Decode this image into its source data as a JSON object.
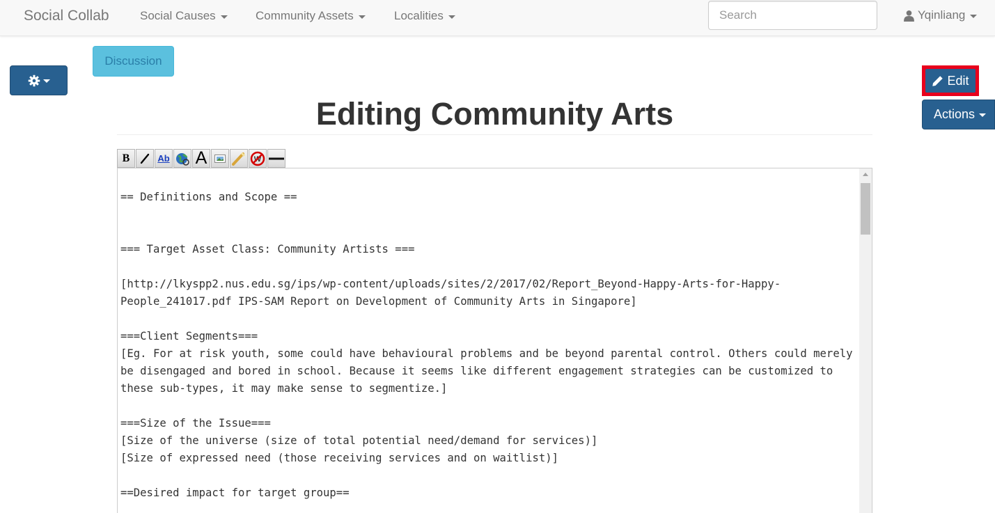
{
  "navbar": {
    "brand": "Social Collab",
    "menus": [
      {
        "label": "Social Causes"
      },
      {
        "label": "Community Assets"
      },
      {
        "label": "Localities"
      }
    ],
    "search_placeholder": "Search",
    "user": "Yqinliang"
  },
  "buttons": {
    "discussion": "Discussion",
    "edit": "Edit",
    "actions": "Actions"
  },
  "page": {
    "title": "Editing Community Arts"
  },
  "toolbar": {
    "tools": [
      "bold-icon",
      "italic-icon",
      "internal-link-icon",
      "external-link-icon",
      "headline-icon",
      "embedded-file-icon",
      "media-file-icon",
      "nowiki-icon",
      "horizontal-line-icon"
    ]
  },
  "editor": {
    "content": "== Definitions and Scope ==\n\n\n=== Target Asset Class: Community Artists ===\n\n[http://lkyspp2.nus.edu.sg/ips/wp-content/uploads/sites/2/2017/02/Report_Beyond-Happy-Arts-for-Happy-People_241017.pdf IPS-SAM Report on Development of Community Arts in Singapore]\n\n===Client Segments===\n[Eg. For at risk youth, some could have behavioural problems and be beyond parental control. Others could merely be disengaged and bored in school. Because it seems like different engagement strategies can be customized to these sub-types, it may make sense to segmentize.]\n\n===Size of the Issue===\n[Size of the universe (size of total potential need/demand for services)]\n[Size of expressed need (those receiving services and on waitlist)]\n\n==Desired impact for target group==\n"
  },
  "colors": {
    "primary": "#286090",
    "info": "#5bc0de",
    "highlight": "#e8001c"
  }
}
